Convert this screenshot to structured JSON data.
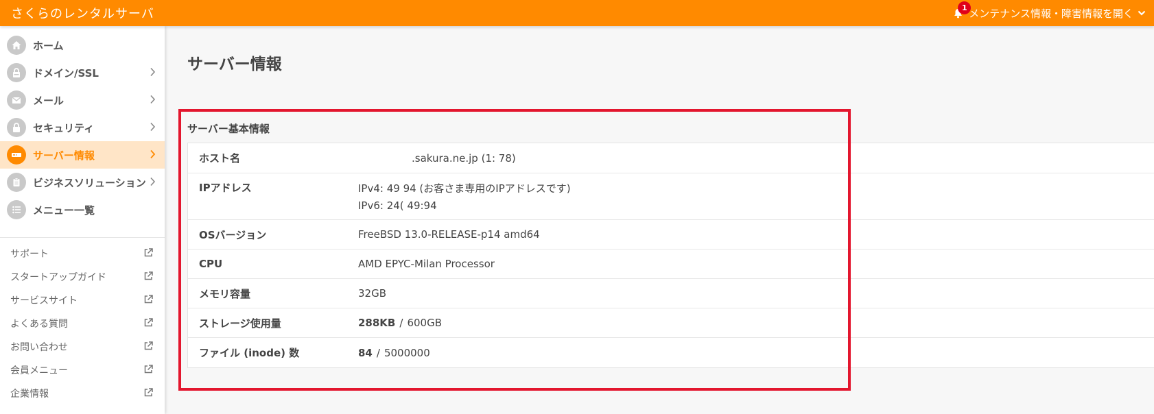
{
  "header": {
    "brand": "さくらのレンタルサーバ",
    "notification_count": "1",
    "maintenance_label": "メンテナンス情報・障害情報を開く"
  },
  "sidebar": {
    "items": [
      {
        "label": "ホーム",
        "icon": "home-icon"
      },
      {
        "label": "ドメイン/SSL",
        "icon": "lock-icon"
      },
      {
        "label": "メール",
        "icon": "mail-icon"
      },
      {
        "label": "セキュリティ",
        "icon": "padlock-icon"
      },
      {
        "label": "サーバー情報",
        "icon": "server-icon"
      },
      {
        "label": "ビジネスソリューション",
        "icon": "clipboard-icon"
      },
      {
        "label": "メニュー一覧",
        "icon": "list-icon"
      }
    ],
    "links": [
      "サポート",
      "スタートアップガイド",
      "サービスサイト",
      "よくある質問",
      "お問い合わせ",
      "会員メニュー",
      "企業情報"
    ]
  },
  "main": {
    "page_title": "サーバー情報",
    "section_title": "サーバー基本情報",
    "rows": {
      "hostname": {
        "key": "ホスト名",
        "value": ".sakura.ne.jp (1:                    78)"
      },
      "ip": {
        "key": "IPアドレス",
        "ipv4": "IPv4: 49               94 (お客さま専用のIPアドレスです)",
        "ipv6": "IPv6: 24(                                        49:94"
      },
      "os": {
        "key": "OSバージョン",
        "value": "FreeBSD 13.0-RELEASE-p14 amd64"
      },
      "cpu": {
        "key": "CPU",
        "value": "AMD EPYC-Milan Processor"
      },
      "memory": {
        "key": "メモリ容量",
        "value": "32GB"
      },
      "storage": {
        "key": "ストレージ使用量",
        "used": "288KB",
        "sep": "/",
        "total": "600GB"
      },
      "inode": {
        "key": "ファイル (inode) 数",
        "used": "84",
        "sep": "/",
        "total": "5000000"
      }
    }
  },
  "colors": {
    "accent": "#ff8a00",
    "active_bg": "#ffe5c7",
    "highlight_frame": "#e3162e"
  }
}
